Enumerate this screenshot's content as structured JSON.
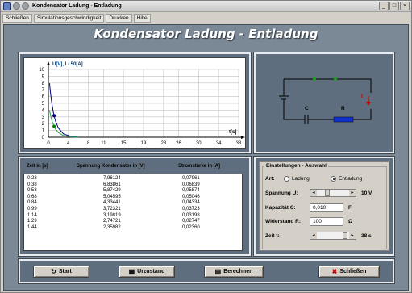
{
  "window": {
    "title": "Kondensator Ladung - Entladung"
  },
  "menu": [
    {
      "label": "Schließen"
    },
    {
      "label": "Simulationsgeschwindigkeit"
    },
    {
      "label": "Drucken"
    },
    {
      "label": "Hilfe"
    }
  ],
  "banner": "Kondensator Ladung - Entladung",
  "chart_data": {
    "type": "line",
    "legend_label": "U[V], I · 50[A]",
    "xlabel": "t[s]",
    "x_ticks": [
      0,
      4,
      8,
      11,
      15,
      19,
      23,
      26,
      30,
      34,
      38
    ],
    "y_ticks": [
      0,
      1,
      2,
      3,
      4,
      5,
      6,
      7,
      8,
      9,
      10
    ],
    "xlim": [
      0,
      38
    ],
    "ylim": [
      0,
      10
    ],
    "series": [
      {
        "t": [
          0.23,
          0.38,
          0.53,
          0.68,
          0.84,
          0.99,
          1.14,
          1.29,
          1.44,
          2.0,
          3.0,
          4.5,
          6.0
        ],
        "u": [
          7.96,
          6.84,
          5.87,
          5.05,
          4.33,
          3.72,
          3.19,
          2.75,
          2.36,
          1.35,
          0.5,
          0.12,
          0.03
        ]
      },
      {
        "t": [
          0.23,
          0.38,
          0.53,
          0.68,
          0.84,
          0.99,
          1.14,
          1.29,
          1.44,
          2.0,
          3.0,
          4.5,
          6.0
        ],
        "i50": [
          3.98,
          3.42,
          2.94,
          2.52,
          2.17,
          1.86,
          1.6,
          1.37,
          1.18,
          0.68,
          0.25,
          0.06,
          0.02
        ]
      }
    ],
    "markers": [
      {
        "t": 1.14,
        "v": 3.19,
        "color": "#000080"
      },
      {
        "t": 1.14,
        "v": 1.6,
        "color": "#008000"
      }
    ]
  },
  "circuit": {
    "capacitor_label": "C",
    "resistor_label": "R",
    "current_label": "I"
  },
  "table": {
    "headers": [
      "Zeit in [s]",
      "Spannung Kondensator in [V]",
      "Stromstärke in [A]"
    ],
    "time": [
      "0,23",
      "0,38",
      "0,53",
      "0,68",
      "0,84",
      "0,99",
      "1,14",
      "1,29",
      "1,44"
    ],
    "voltage": [
      "7,96124",
      "6,83861",
      "5,87429",
      "5,04595",
      "4,33441",
      "3,72321",
      "3,19819",
      "2,74721",
      "2,35982"
    ],
    "current": [
      "0,07961",
      "0,06839",
      "0,05874",
      "0,05046",
      "0,04334",
      "0,03723",
      "0,03198",
      "0,02747",
      "0,02360"
    ]
  },
  "settings": {
    "group_label": "Einstellungen - Auswahl",
    "art_label": "Art:",
    "art_options": [
      "Ladung",
      "Entladung"
    ],
    "art_selected": "Entladung",
    "voltage_label": "Spannung U:",
    "voltage_value": "10 V",
    "voltage_level": 0.3,
    "capacitance_label": "Kapazität C:",
    "capacitance_value": "0,010",
    "capacitance_unit": "F",
    "resistance_label": "Widerstand R:",
    "resistance_value": "100",
    "resistance_unit": "Ω",
    "time_label": "Zeit t:",
    "time_value": "38 s",
    "time_level": 0.95
  },
  "buttons": {
    "start": "Start",
    "reset": "Urzustand",
    "calc": "Berechnen",
    "close": "Schließen"
  }
}
